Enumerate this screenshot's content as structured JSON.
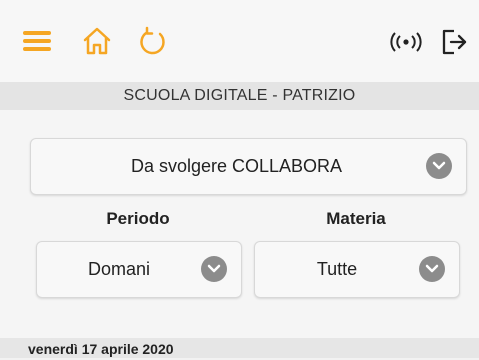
{
  "header": {
    "title": "SCUOLA DIGITALE - PATRIZIO",
    "icons": {
      "menu": "menu-icon",
      "home": "home-icon",
      "refresh": "refresh-icon",
      "broadcast": "broadcast-icon",
      "logout": "logout-icon"
    },
    "accent_color": "#f5a623"
  },
  "filters": {
    "main_select": {
      "value": "Da svolgere COLLABORA"
    },
    "periodo": {
      "label": "Periodo",
      "value": "Domani"
    },
    "materia": {
      "label": "Materia",
      "value": "Tutte"
    }
  },
  "list": {
    "date_header": "venerdì 17 aprile 2020"
  }
}
